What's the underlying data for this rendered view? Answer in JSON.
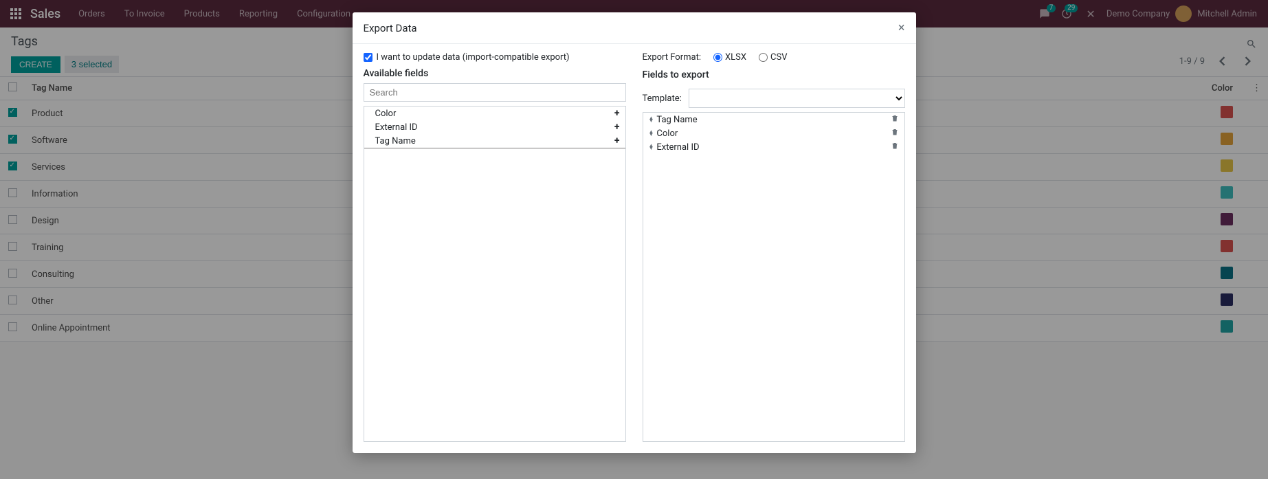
{
  "topnav": {
    "brand": "Sales",
    "items": [
      "Orders",
      "To Invoice",
      "Products",
      "Reporting",
      "Configuration"
    ],
    "badges": {
      "messages": "7",
      "activities": "29"
    },
    "company": "Demo Company",
    "user": "Mitchell Admin"
  },
  "control": {
    "breadcrumb": "Tags",
    "create": "CREATE",
    "selected": "3 selected",
    "pager": "1-9 / 9"
  },
  "list": {
    "headers": {
      "name": "Tag Name",
      "color": "Color"
    },
    "rows": [
      {
        "checked": true,
        "name": "Product",
        "color": "#d9534f"
      },
      {
        "checked": true,
        "name": "Software",
        "color": "#e5a33b"
      },
      {
        "checked": true,
        "name": "Services",
        "color": "#e7c547"
      },
      {
        "checked": false,
        "name": "Information",
        "color": "#3fbfbf"
      },
      {
        "checked": false,
        "name": "Design",
        "color": "#6b2e5f"
      },
      {
        "checked": false,
        "name": "Training",
        "color": "#d9534f"
      },
      {
        "checked": false,
        "name": "Consulting",
        "color": "#0b7285"
      },
      {
        "checked": false,
        "name": "Other",
        "color": "#2b2e63"
      },
      {
        "checked": false,
        "name": "Online Appointment",
        "color": "#20a3a3"
      }
    ]
  },
  "modal": {
    "title": "Export Data",
    "update_label": "I want to update data (import-compatible export)",
    "available_title": "Available fields",
    "search_placeholder": "Search",
    "available_fields": [
      "Color",
      "External ID",
      "Tag Name"
    ],
    "selected_available_index": 2,
    "format_label": "Export Format:",
    "format_xlsx": "XLSX",
    "format_csv": "CSV",
    "export_title": "Fields to export",
    "template_label": "Template:",
    "export_fields": [
      "Tag Name",
      "Color",
      "External ID"
    ]
  }
}
